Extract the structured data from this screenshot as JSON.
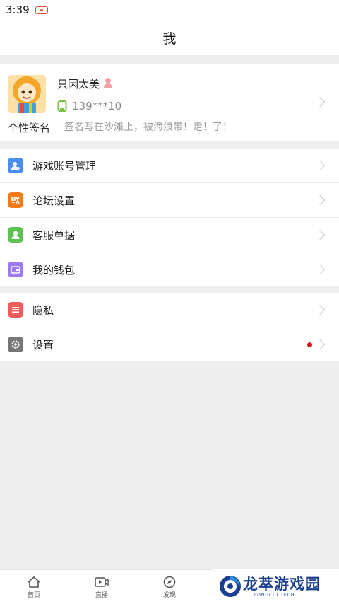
{
  "status_bar": {
    "time": "3:39",
    "notif_icon": "news-app-icon"
  },
  "header": {
    "title": "我"
  },
  "profile": {
    "avatar_icon": "cartoon-avatar-icon",
    "name": "只因太美",
    "gender_icon": "female-user-icon",
    "phone_icon": "phone-icon",
    "phone": "139***10",
    "signature_label": "个性签名",
    "signature": "签名写在沙滩上，被海浪带！走！了！"
  },
  "menu_group_1": [
    {
      "label": "游戏账号管理",
      "icon": "account-icon",
      "color": "#4a8ef0"
    },
    {
      "label": "论坛设置",
      "icon": "forum-icon",
      "color": "#f27b1c"
    },
    {
      "label": "客服单据",
      "icon": "service-icon",
      "color": "#5cc353"
    },
    {
      "label": "我的钱包",
      "icon": "wallet-icon",
      "color": "#9b7cf0"
    }
  ],
  "menu_group_2": [
    {
      "label": "隐私",
      "icon": "privacy-icon",
      "color": "#f05c5c"
    },
    {
      "label": "设置",
      "icon": "gear-icon",
      "color": "#777777"
    }
  ],
  "tabs": [
    {
      "label": "首页",
      "icon": "home-icon"
    },
    {
      "label": "直播",
      "icon": "video-icon"
    },
    {
      "label": "发现",
      "icon": "compass-icon"
    }
  ],
  "watermark": {
    "name": "龙萃游戏园",
    "sub": "LONGCUI TECH"
  },
  "colors": {
    "accent_red": "#e0161a",
    "watermark_blue": "#1a3f8f"
  }
}
